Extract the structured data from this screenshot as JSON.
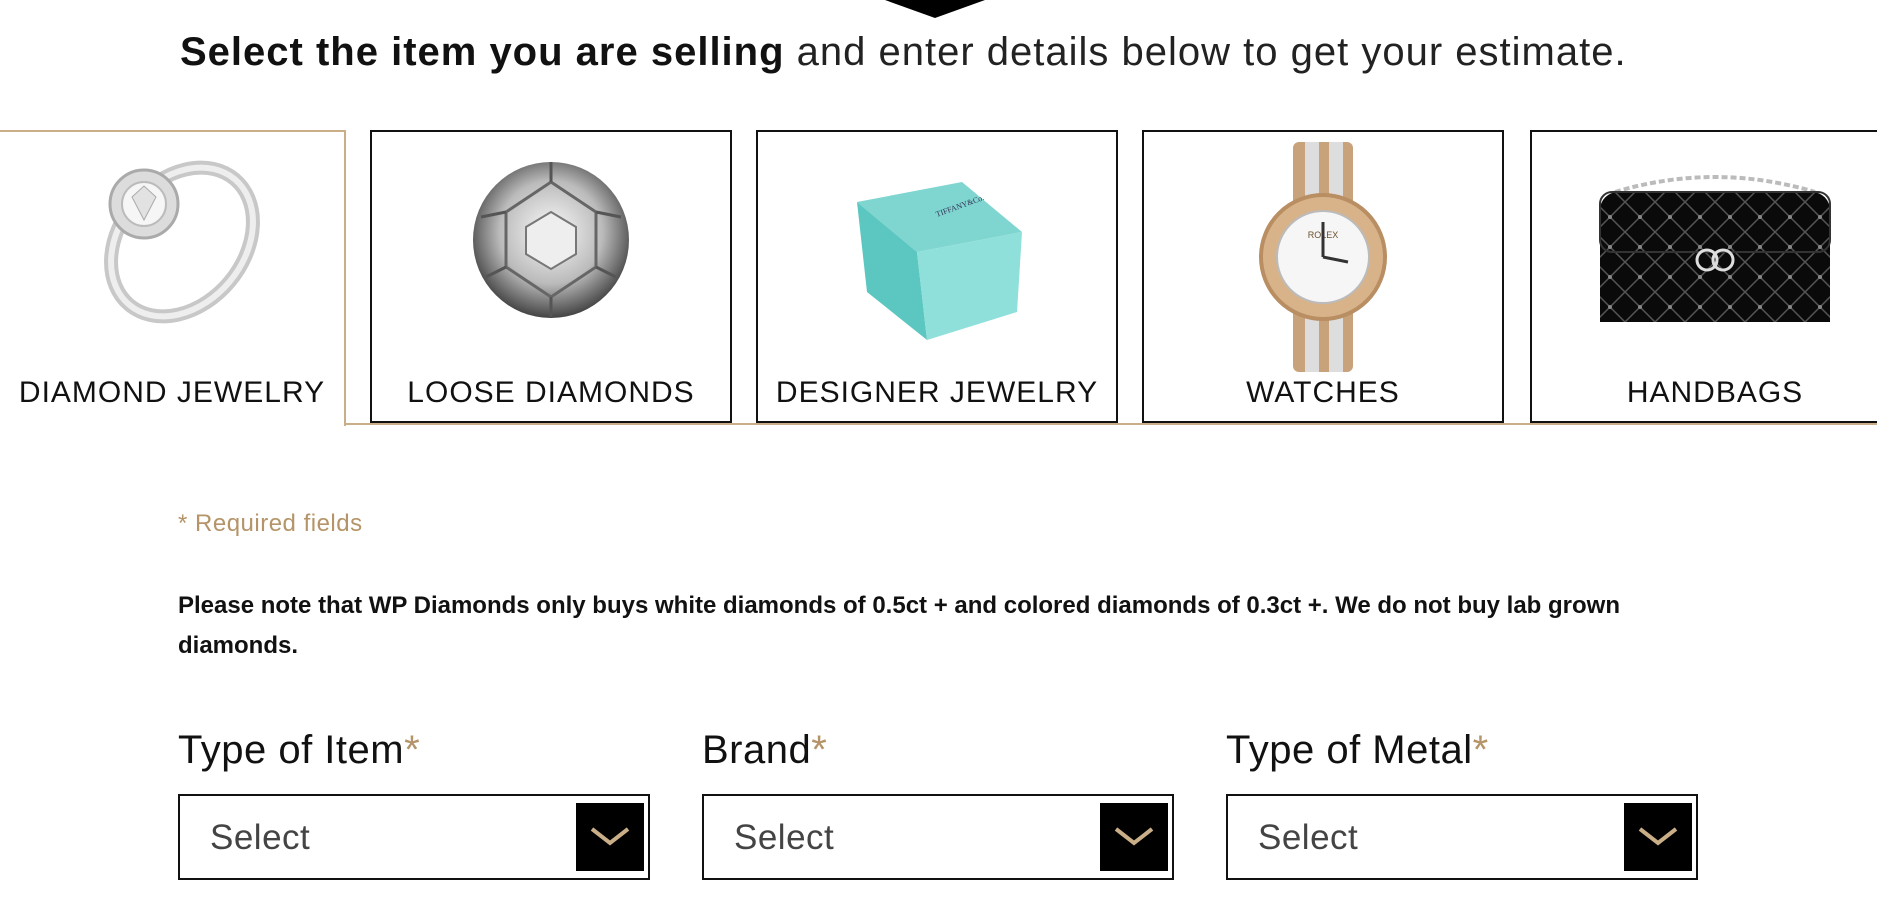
{
  "headline": {
    "bold": "Select the item you are selling",
    "rest": " and enter details below to get your estimate."
  },
  "categories": [
    {
      "label": "DIAMOND JEWELRY",
      "icon": "diamond-ring-image",
      "active": true
    },
    {
      "label": "LOOSE DIAMONDS",
      "icon": "loose-diamond-image",
      "active": false
    },
    {
      "label": "DESIGNER JEWELRY",
      "icon": "tiffany-box-image",
      "active": false
    },
    {
      "label": "WATCHES",
      "icon": "watch-image",
      "active": false
    },
    {
      "label": "HANDBAGS",
      "icon": "handbag-image",
      "active": false
    }
  ],
  "tiffany_text": "TIFFANY&Co.",
  "watch_text": "ROLEX",
  "required_text": "* Required fields",
  "notice": "Please note that WP Diamonds only buys white diamonds of 0.5ct + and colored diamonds of 0.3ct +. We do not buy lab grown diamonds.",
  "fields": [
    {
      "label": "Type of Item",
      "star": "*",
      "value": "Select"
    },
    {
      "label": "Brand",
      "star": "*",
      "value": "Select"
    },
    {
      "label": "Type of Metal",
      "star": "*",
      "value": "Select"
    }
  ],
  "colors": {
    "accent": "#c9ae88",
    "star": "#b49468",
    "dark": "#000000"
  }
}
